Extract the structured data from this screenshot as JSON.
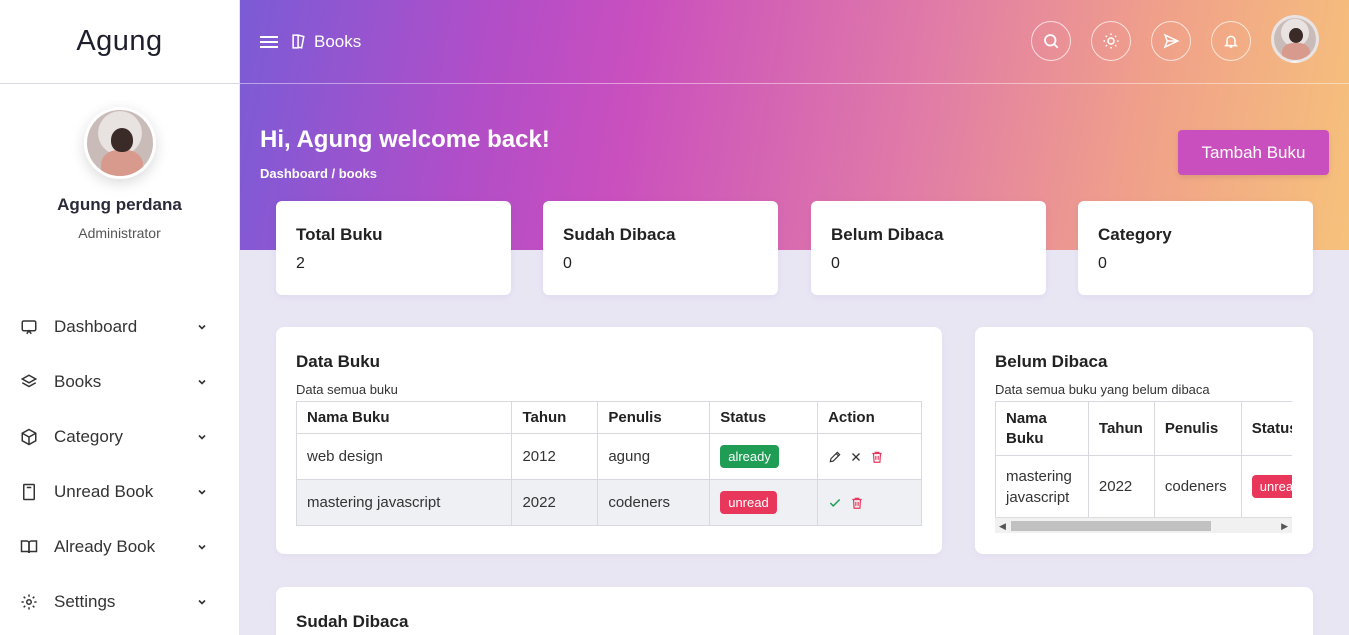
{
  "brand": "Agung",
  "profile": {
    "name": "Agung perdana",
    "role": "Administrator"
  },
  "menu": [
    {
      "label": "Dashboard",
      "icon": "monitor-icon"
    },
    {
      "label": "Books",
      "icon": "layers-icon"
    },
    {
      "label": "Category",
      "icon": "box-icon"
    },
    {
      "label": "Unread Book",
      "icon": "bookmark-icon"
    },
    {
      "label": "Already Book",
      "icon": "open-book-icon"
    },
    {
      "label": "Settings",
      "icon": "gear-icon"
    }
  ],
  "topbar": {
    "title": "Books"
  },
  "greeting": "Hi, Agung welcome back!",
  "breadcrumb": "Dashboard / books",
  "add_button": "Tambah Buku",
  "stats": [
    {
      "label": "Total Buku",
      "value": "2"
    },
    {
      "label": "Sudah Dibaca",
      "value": "0"
    },
    {
      "label": "Belum Dibaca",
      "value": "0"
    },
    {
      "label": "Category",
      "value": "0"
    }
  ],
  "data_buku": {
    "title": "Data Buku",
    "subtitle": "Data semua buku",
    "headers": [
      "Nama Buku",
      "Tahun",
      "Penulis",
      "Status",
      "Action"
    ],
    "rows": [
      {
        "nama": "web design",
        "tahun": "2012",
        "penulis": "agung",
        "status": "already"
      },
      {
        "nama": "mastering javascript",
        "tahun": "2022",
        "penulis": "codeners",
        "status": "unread"
      }
    ]
  },
  "belum_dibaca": {
    "title": "Belum Dibaca",
    "subtitle": "Data semua buku yang belum dibaca",
    "headers": [
      "Nama Buku",
      "Tahun",
      "Penulis",
      "Status"
    ],
    "rows": [
      {
        "nama": "mastering javascript",
        "tahun": "2022",
        "penulis": "codeners",
        "status": "unread"
      }
    ]
  },
  "sudah_dibaca": {
    "title": "Sudah Dibaca"
  },
  "colors": {
    "accent": "#c94fbe",
    "already": "#1f9d55",
    "unread": "#e8375a"
  }
}
